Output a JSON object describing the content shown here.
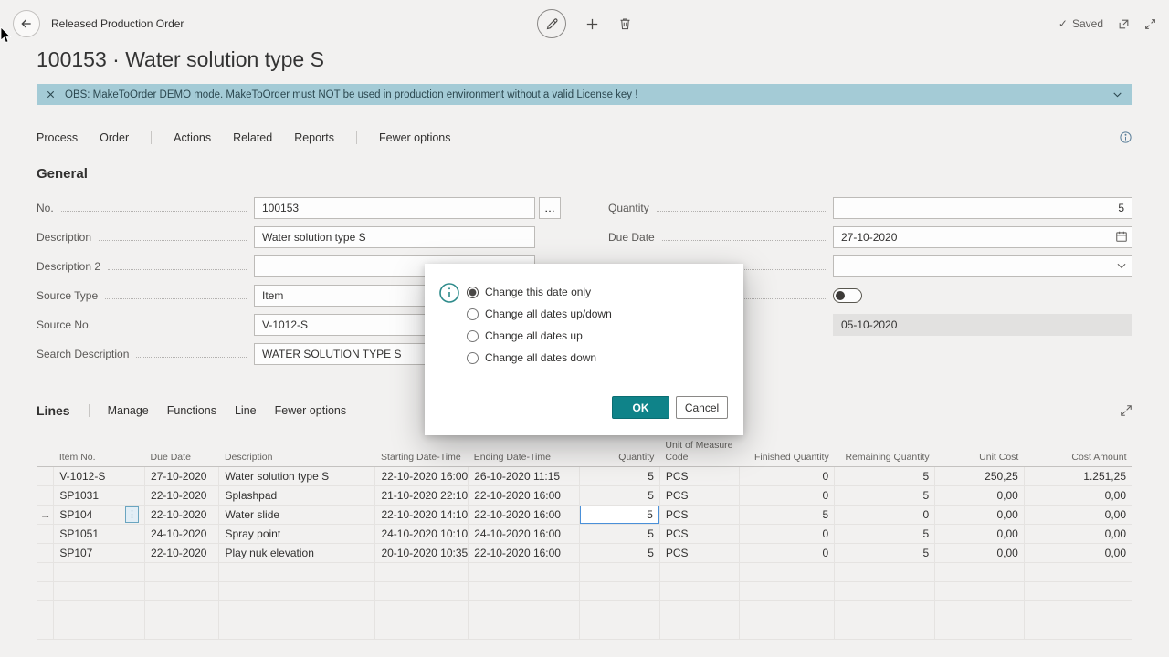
{
  "icons": {
    "ellipsis": "…",
    "check": "✓",
    "row_arrow": "→",
    "dots_vertical": "⋮"
  },
  "topbar": {
    "caption": "Released Production Order",
    "saved": "Saved"
  },
  "page_title": "100153 · Water solution type S",
  "banner": {
    "text": "OBS: MakeToOrder DEMO mode. MakeToOrder must NOT be used in production environment without a valid License key !"
  },
  "menubar": {
    "items": [
      "Process",
      "Order",
      "Actions",
      "Related",
      "Reports",
      "Fewer options"
    ]
  },
  "general": {
    "title": "General",
    "left": [
      {
        "label": "No.",
        "value": "100153"
      },
      {
        "label": "Description",
        "value": "Water solution type S"
      },
      {
        "label": "Description 2",
        "value": ""
      },
      {
        "label": "Source Type",
        "value": "Item"
      },
      {
        "label": "Source No.",
        "value": "V-1012-S"
      },
      {
        "label": "Search Description",
        "value": "WATER SOLUTION TYPE S"
      }
    ],
    "right": {
      "quantity": {
        "label": "Quantity",
        "value": "5"
      },
      "due_date": {
        "label": "Due Date",
        "value": "27-10-2020"
      },
      "combo": {
        "label": "",
        "value": ""
      },
      "toggle": {
        "label": "",
        "on": false
      },
      "date2": {
        "label": "",
        "value": "05-10-2020"
      }
    }
  },
  "dialog": {
    "options": [
      {
        "label": "Change this date only",
        "selected": true
      },
      {
        "label": "Change all dates up/down",
        "selected": false
      },
      {
        "label": "Change all dates up",
        "selected": false
      },
      {
        "label": "Change all dates down",
        "selected": false
      }
    ],
    "ok": "OK",
    "cancel": "Cancel"
  },
  "lines": {
    "title": "Lines",
    "menu": [
      "Manage",
      "Functions",
      "Line",
      "Fewer options"
    ],
    "columns": [
      "Item No.",
      "Due Date",
      "Description",
      "Starting Date-Time",
      "Ending Date-Time",
      "Quantity",
      "Unit of Measure Code",
      "Finished Quantity",
      "Remaining Quantity",
      "Unit Cost",
      "Cost Amount"
    ],
    "rows": [
      [
        "V-1012-S",
        "27-10-2020",
        "Water solution type S",
        "22-10-2020 16:00",
        "26-10-2020 11:15",
        "5",
        "PCS",
        "0",
        "5",
        "250,25",
        "1.251,25"
      ],
      [
        "SP1031",
        "22-10-2020",
        "Splashpad",
        "21-10-2020 22:10",
        "22-10-2020 16:00",
        "5",
        "PCS",
        "0",
        "5",
        "0,00",
        "0,00"
      ],
      [
        "SP104",
        "22-10-2020",
        "Water slide",
        "22-10-2020 14:10",
        "22-10-2020 16:00",
        "5",
        "PCS",
        "5",
        "0",
        "0,00",
        "0,00"
      ],
      [
        "SP1051",
        "24-10-2020",
        "Spray point",
        "24-10-2020 10:10",
        "24-10-2020 16:00",
        "5",
        "PCS",
        "0",
        "5",
        "0,00",
        "0,00"
      ],
      [
        "SP107",
        "22-10-2020",
        "Play nuk elevation",
        "20-10-2020 10:35",
        "22-10-2020 16:00",
        "5",
        "PCS",
        "0",
        "5",
        "0,00",
        "0,00"
      ]
    ]
  }
}
